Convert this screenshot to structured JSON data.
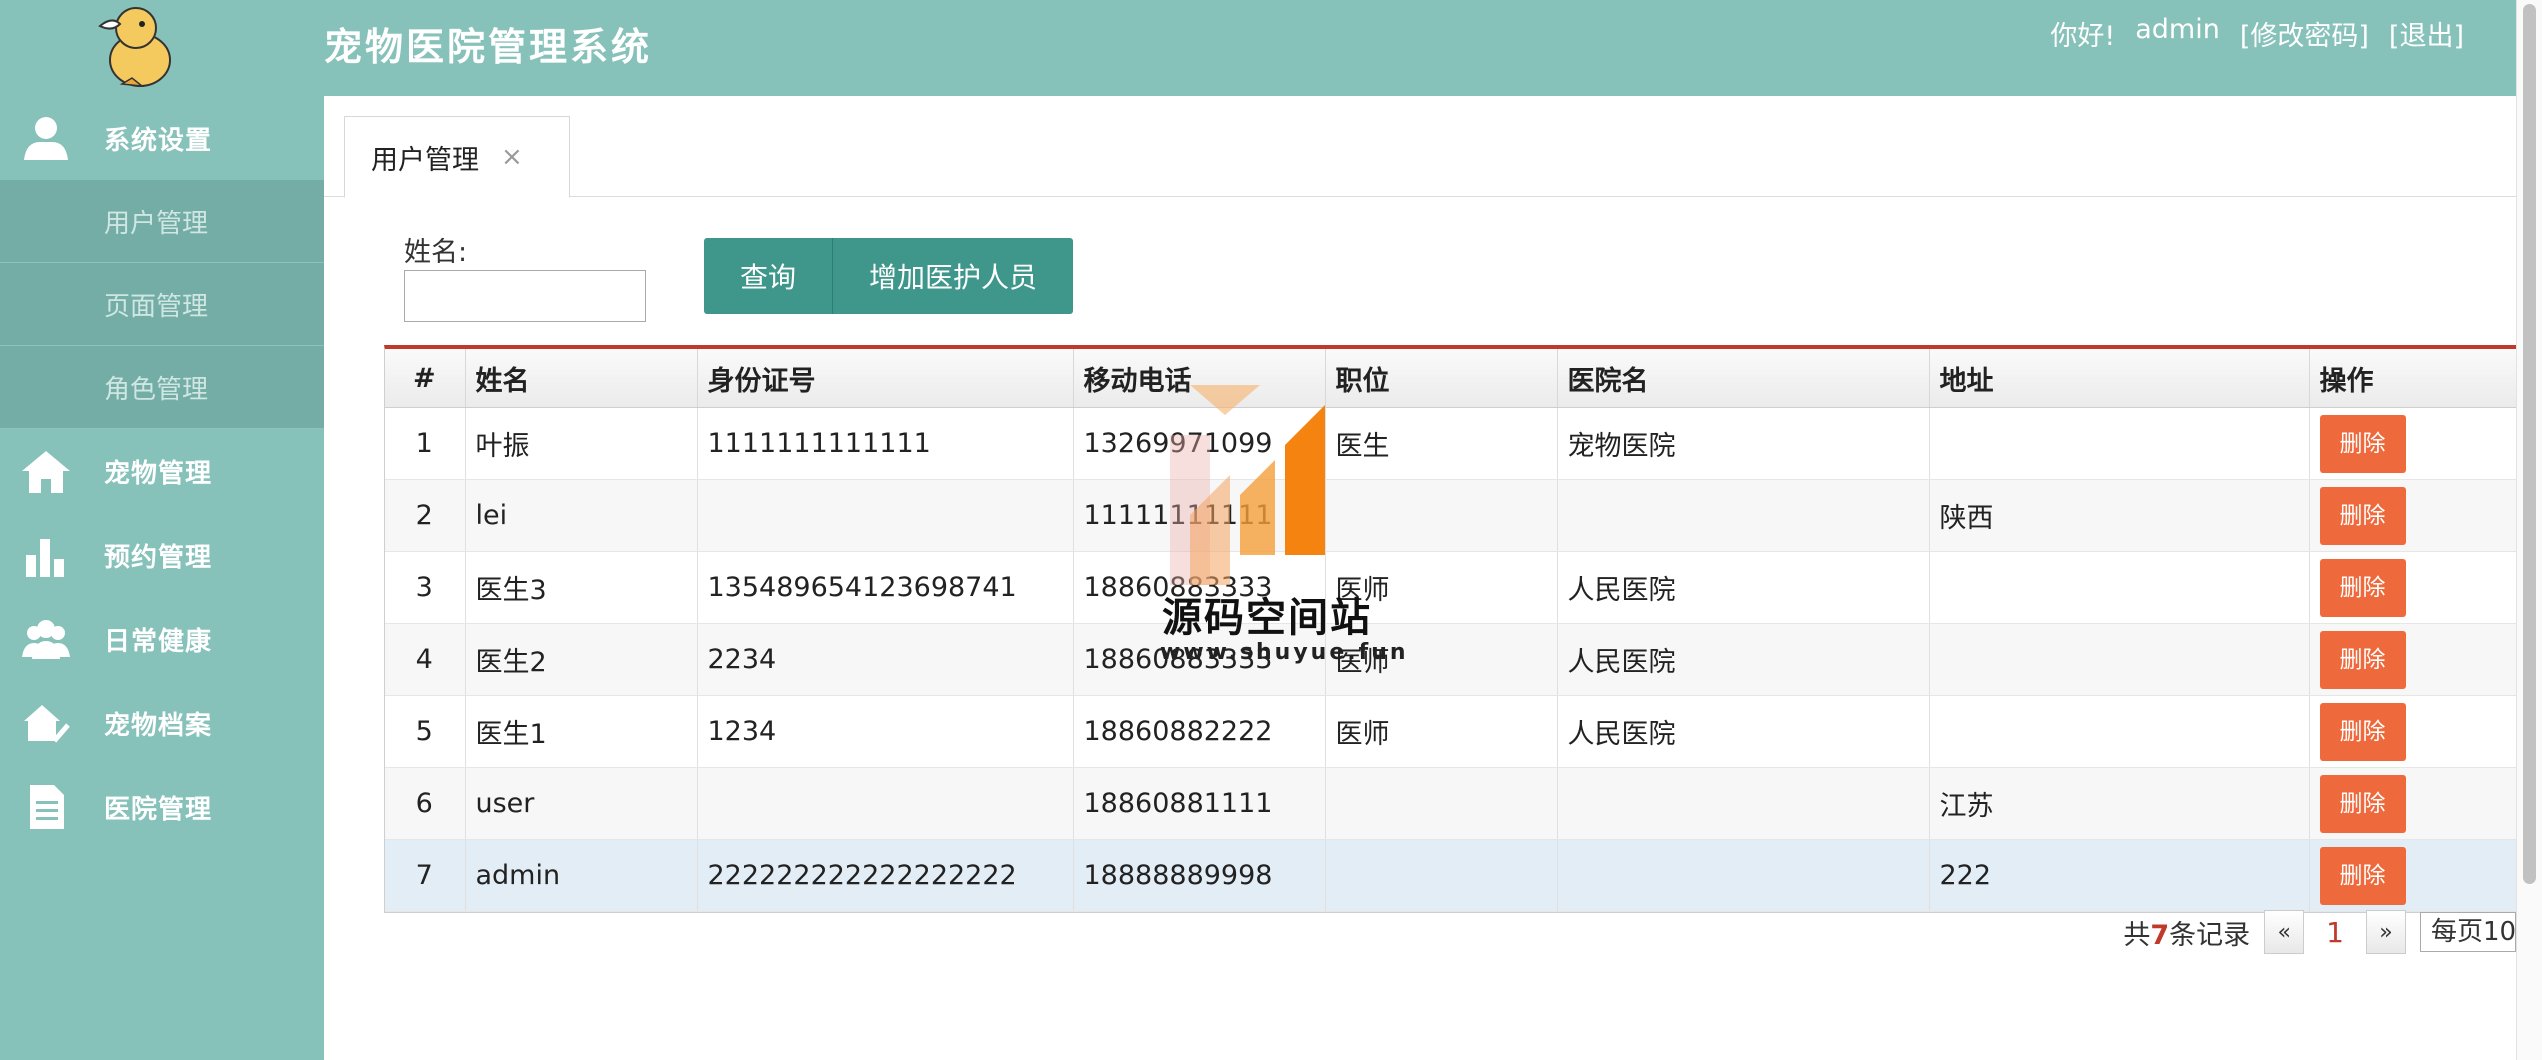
{
  "header": {
    "title": "宠物医院管理系统",
    "greeting": "你好!",
    "username": "admin",
    "change_password": "[修改密码]",
    "logout": "[退出]"
  },
  "sidebar": {
    "items": [
      {
        "label": "系统设置",
        "icon": "user-icon"
      },
      {
        "label": "宠物管理",
        "icon": "home-icon"
      },
      {
        "label": "预约管理",
        "icon": "bar-chart-icon"
      },
      {
        "label": "日常健康",
        "icon": "group-icon"
      },
      {
        "label": "宠物档案",
        "icon": "pet-check-icon"
      },
      {
        "label": "医院管理",
        "icon": "document-icon"
      }
    ],
    "submenu": [
      {
        "label": "用户管理"
      },
      {
        "label": "页面管理"
      },
      {
        "label": "角色管理"
      }
    ]
  },
  "tabs": [
    {
      "label": "用户管理",
      "close": "×"
    }
  ],
  "search": {
    "name_label": "姓名:",
    "name_value": "",
    "query_button": "查询",
    "add_button": "增加医护人员"
  },
  "table": {
    "headers": [
      "#",
      "姓名",
      "身份证号",
      "移动电话",
      "职位",
      "医院名",
      "地址",
      "操作"
    ],
    "rows": [
      {
        "idx": "1",
        "name": "叶振",
        "id": "1111111111111",
        "phone": "13269971099",
        "title": "医生",
        "hospital": "宠物医院",
        "addr": "",
        "action": "删除"
      },
      {
        "idx": "2",
        "name": "lei",
        "id": "",
        "phone": "11111111111",
        "title": "",
        "hospital": "",
        "addr": "陕西",
        "action": "删除"
      },
      {
        "idx": "3",
        "name": "医生3",
        "id": "135489654123698741",
        "phone": "18860883333",
        "title": "医师",
        "hospital": "人民医院",
        "addr": "",
        "action": "删除"
      },
      {
        "idx": "4",
        "name": "医生2",
        "id": "2234",
        "phone": "18860883333",
        "title": "医师",
        "hospital": "人民医院",
        "addr": "",
        "action": "删除"
      },
      {
        "idx": "5",
        "name": "医生1",
        "id": "1234",
        "phone": "18860882222",
        "title": "医师",
        "hospital": "人民医院",
        "addr": "",
        "action": "删除"
      },
      {
        "idx": "6",
        "name": "user",
        "id": "",
        "phone": "18860881111",
        "title": "",
        "hospital": "",
        "addr": "江苏",
        "action": "删除"
      },
      {
        "idx": "7",
        "name": "admin",
        "id": "222222222222222222",
        "phone": "18888889998",
        "title": "",
        "hospital": "",
        "addr": "222",
        "action": "删除"
      }
    ]
  },
  "pager": {
    "prefix": "共",
    "total": "7",
    "suffix": "条记录",
    "prev": "«",
    "current": "1",
    "next": "»",
    "page_size": "每页10"
  },
  "watermark": {
    "cn": "源码空间站",
    "en": "www.shuyue.fun"
  },
  "colors": {
    "theme": "#86c1ba",
    "submenu": "#73ada6",
    "button": "#3f978b",
    "delete": "#ee6a3c",
    "accent_line": "#c0392b"
  }
}
